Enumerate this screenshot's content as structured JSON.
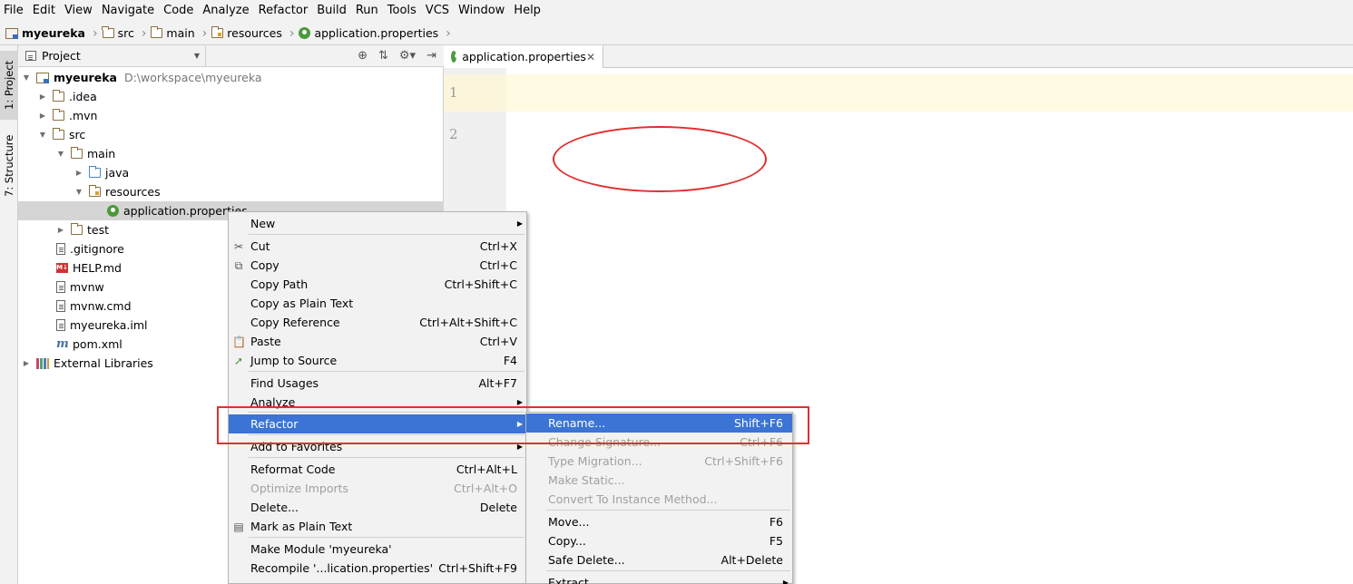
{
  "menubar": [
    "File",
    "Edit",
    "View",
    "Navigate",
    "Code",
    "Analyze",
    "Refactor",
    "Build",
    "Run",
    "Tools",
    "VCS",
    "Window",
    "Help"
  ],
  "breadcrumb": [
    "myeureka",
    "src",
    "main",
    "resources",
    "application.properties"
  ],
  "toolstrip": {
    "project_tab": "1: Project",
    "structure_tab": "7: Structure"
  },
  "project_panel": {
    "view_label": "Project"
  },
  "tree": {
    "root": {
      "label": "myeureka",
      "path": "D:\\workspace\\myeureka"
    },
    "items": [
      ".idea",
      ".mvn",
      "src",
      "main",
      "java",
      "resources",
      "application.properties",
      "test",
      ".gitignore",
      "HELP.md",
      "mvnw",
      "mvnw.cmd",
      "myeureka.iml",
      "pom.xml",
      "External Libraries"
    ]
  },
  "editor": {
    "tab_label": "application.properties",
    "line_numbers": [
      "1",
      "2"
    ]
  },
  "context_menu": {
    "items": [
      {
        "label": "New",
        "shortcut": ""
      },
      {
        "label": "Cut",
        "shortcut": "Ctrl+X"
      },
      {
        "label": "Copy",
        "shortcut": "Ctrl+C"
      },
      {
        "label": "Copy Path",
        "shortcut": "Ctrl+Shift+C"
      },
      {
        "label": "Copy as Plain Text",
        "shortcut": ""
      },
      {
        "label": "Copy Reference",
        "shortcut": "Ctrl+Alt+Shift+C"
      },
      {
        "label": "Paste",
        "shortcut": "Ctrl+V"
      },
      {
        "label": "Jump to Source",
        "shortcut": "F4"
      },
      {
        "label": "Find Usages",
        "shortcut": "Alt+F7"
      },
      {
        "label": "Analyze",
        "shortcut": ""
      },
      {
        "label": "Refactor",
        "shortcut": ""
      },
      {
        "label": "Add to Favorites",
        "shortcut": ""
      },
      {
        "label": "Reformat Code",
        "shortcut": "Ctrl+Alt+L"
      },
      {
        "label": "Optimize Imports",
        "shortcut": "Ctrl+Alt+O"
      },
      {
        "label": "Delete...",
        "shortcut": "Delete"
      },
      {
        "label": "Mark as Plain Text",
        "shortcut": ""
      },
      {
        "label": "Make Module 'myeureka'",
        "shortcut": ""
      },
      {
        "label": "Recompile '...lication.properties'",
        "shortcut": "Ctrl+Shift+F9"
      }
    ]
  },
  "refactor_submenu": {
    "items": [
      {
        "label": "Rename...",
        "shortcut": "Shift+F6"
      },
      {
        "label": "Change Signature...",
        "shortcut": "Ctrl+F6"
      },
      {
        "label": "Type Migration...",
        "shortcut": "Ctrl+Shift+F6"
      },
      {
        "label": "Make Static...",
        "shortcut": ""
      },
      {
        "label": "Convert To Instance Method...",
        "shortcut": ""
      },
      {
        "label": "Move...",
        "shortcut": "F6"
      },
      {
        "label": "Copy...",
        "shortcut": "F5"
      },
      {
        "label": "Safe Delete...",
        "shortcut": "Alt+Delete"
      },
      {
        "label": "Extract",
        "shortcut": ""
      }
    ]
  },
  "colors": {
    "highlight": "#3b74d4",
    "annotation": "#e03030"
  }
}
